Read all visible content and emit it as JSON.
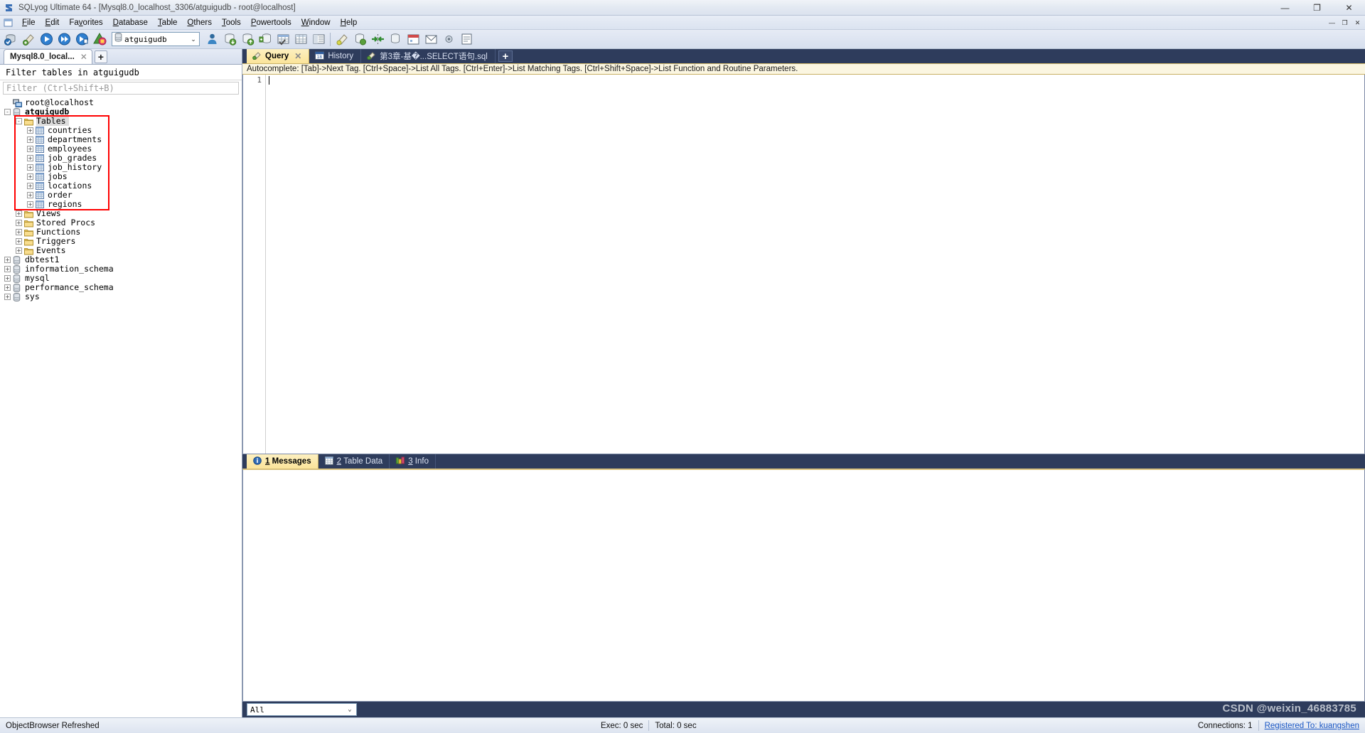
{
  "window": {
    "title": "SQLyog Ultimate 64 - [Mysql8.0_localhost_3306/atguigudb - root@localhost]",
    "app_icon": "sqlyog-icon",
    "minimize": "—",
    "maximize": "❐",
    "close": "✕",
    "mdi_minimize": "—",
    "mdi_restore": "❐",
    "mdi_close": "✕"
  },
  "menu": {
    "items": [
      {
        "label": "File",
        "accel": "F"
      },
      {
        "label": "Edit",
        "accel": "E"
      },
      {
        "label": "Favorites",
        "accel": "v"
      },
      {
        "label": "Database",
        "accel": "D"
      },
      {
        "label": "Table",
        "accel": "T"
      },
      {
        "label": "Others",
        "accel": "O"
      },
      {
        "label": "Tools",
        "accel": "T"
      },
      {
        "label": "Powertools",
        "accel": "P"
      },
      {
        "label": "Window",
        "accel": "W"
      },
      {
        "label": "Help",
        "accel": "H"
      }
    ]
  },
  "toolbar": {
    "buttons": [
      {
        "name": "new-connection-icon",
        "tip": "New Connection"
      },
      {
        "name": "refresh-object-browser-icon",
        "tip": "Refresh Object Browser"
      },
      {
        "name": "execute-query-icon",
        "tip": "Execute Query"
      },
      {
        "name": "execute-all-queries-icon",
        "tip": "Execute All Queries"
      },
      {
        "name": "execute-query-new-tab-icon",
        "tip": "Execute Query in New Tab"
      },
      {
        "name": "stop-query-icon",
        "tip": "Stop Query"
      }
    ],
    "database_selector": {
      "value": "atguigudb",
      "icon": "database-icon",
      "arrow": "⌄"
    },
    "buttons2": [
      {
        "name": "user-manager-icon",
        "tip": "User Manager"
      },
      {
        "name": "backup-database-icon",
        "tip": "Backup Database"
      },
      {
        "name": "restore-database-icon",
        "tip": "Restore From SQL Dump"
      },
      {
        "name": "import-external-data-icon",
        "tip": "Import External Data"
      },
      {
        "name": "create-table-icon",
        "tip": "Create Table"
      },
      {
        "name": "table-data-icon",
        "tip": "Table Data"
      },
      {
        "name": "manage-indexes-icon",
        "tip": "Manage Indexes"
      }
    ],
    "buttons3": [
      {
        "name": "query-builder-icon",
        "tip": "Query Builder"
      },
      {
        "name": "schema-designer-icon",
        "tip": "Schema Designer"
      },
      {
        "name": "sync-data-icon",
        "tip": "Data Synchronization"
      },
      {
        "name": "schema-sync-icon",
        "tip": "Schema Synchronization"
      },
      {
        "name": "scheduled-backup-icon",
        "tip": "Scheduled Backups"
      },
      {
        "name": "notification-icon",
        "tip": "Notification Services"
      },
      {
        "name": "preferences-icon",
        "tip": "Preferences"
      },
      {
        "name": "sql-formatter-icon",
        "tip": "SQL Formatter"
      }
    ]
  },
  "object_browser": {
    "connection_tab": {
      "label": "Mysql8.0_local...",
      "close": "✕"
    },
    "add_tab": "+",
    "filter_title": "Filter tables in atguigudb",
    "filter_placeholder": "Filter (Ctrl+Shift+B)",
    "root": {
      "label": "root@localhost",
      "icon": "host-icon"
    },
    "nodes": [
      {
        "label": "atguigudb",
        "icon": "database-icon",
        "indent": 1,
        "expander": "-",
        "bold": true
      },
      {
        "label": "Tables",
        "icon": "folder-icon",
        "indent": 2,
        "expander": "-",
        "selected": true
      },
      {
        "label": "countries",
        "icon": "table-icon",
        "indent": 3,
        "expander": "+"
      },
      {
        "label": "departments",
        "icon": "table-icon",
        "indent": 3,
        "expander": "+"
      },
      {
        "label": "employees",
        "icon": "table-icon",
        "indent": 3,
        "expander": "+"
      },
      {
        "label": "job_grades",
        "icon": "table-icon",
        "indent": 3,
        "expander": "+"
      },
      {
        "label": "job_history",
        "icon": "table-icon",
        "indent": 3,
        "expander": "+"
      },
      {
        "label": "jobs",
        "icon": "table-icon",
        "indent": 3,
        "expander": "+"
      },
      {
        "label": "locations",
        "icon": "table-icon",
        "indent": 3,
        "expander": "+"
      },
      {
        "label": "order",
        "icon": "table-icon",
        "indent": 3,
        "expander": "+"
      },
      {
        "label": "regions",
        "icon": "table-icon",
        "indent": 3,
        "expander": "+"
      },
      {
        "label": "Views",
        "icon": "folder-icon",
        "indent": 2,
        "expander": "+"
      },
      {
        "label": "Stored Procs",
        "icon": "folder-icon",
        "indent": 2,
        "expander": "+"
      },
      {
        "label": "Functions",
        "icon": "folder-icon",
        "indent": 2,
        "expander": "+"
      },
      {
        "label": "Triggers",
        "icon": "folder-icon",
        "indent": 2,
        "expander": "+"
      },
      {
        "label": "Events",
        "icon": "folder-icon",
        "indent": 2,
        "expander": "+"
      },
      {
        "label": "dbtest1",
        "icon": "database-icon",
        "indent": 1,
        "expander": "+"
      },
      {
        "label": "information_schema",
        "icon": "database-icon",
        "indent": 1,
        "expander": "+"
      },
      {
        "label": "mysql",
        "icon": "database-icon",
        "indent": 1,
        "expander": "+"
      },
      {
        "label": "performance_schema",
        "icon": "database-icon",
        "indent": 1,
        "expander": "+"
      },
      {
        "label": "sys",
        "icon": "database-icon",
        "indent": 1,
        "expander": "+"
      }
    ],
    "annotation": {
      "color": "#ff0000",
      "note": "red rectangle around Tables folder and its nine tables"
    }
  },
  "editor": {
    "tabs": [
      {
        "label": "Query",
        "icon": "query-icon",
        "active": true,
        "closable": true,
        "close": "✕"
      },
      {
        "label": "History",
        "icon": "calendar-icon",
        "active": false,
        "closable": false
      },
      {
        "label": "第3章-基�...SELECT语句.sql",
        "icon": "sql-file-icon",
        "active": false,
        "closable": false
      }
    ],
    "add_tab": "+",
    "autocomplete_hint": "Autocomplete: [Tab]->Next Tag. [Ctrl+Space]->List All Tags. [Ctrl+Enter]->List Matching Tags. [Ctrl+Shift+Space]->List Function and Routine Parameters.",
    "line_numbers": [
      "1"
    ],
    "content": ""
  },
  "results": {
    "tabs": [
      {
        "number": "1",
        "label": "Messages",
        "icon": "info-icon",
        "active": true
      },
      {
        "number": "2",
        "label": "Table Data",
        "icon": "grid-icon",
        "active": false
      },
      {
        "number": "3",
        "label": "Info",
        "icon": "info-bars-icon",
        "active": false
      }
    ],
    "filter_select": {
      "value": "All",
      "arrow": "⌄"
    }
  },
  "statusbar": {
    "message": "ObjectBrowser Refreshed",
    "exec": "Exec: 0 sec",
    "total": "Total: 0 sec",
    "connections": "Connections: 1",
    "registered": "Registered To: kuangshen"
  },
  "watermark": "CSDN @weixin_46883785"
}
